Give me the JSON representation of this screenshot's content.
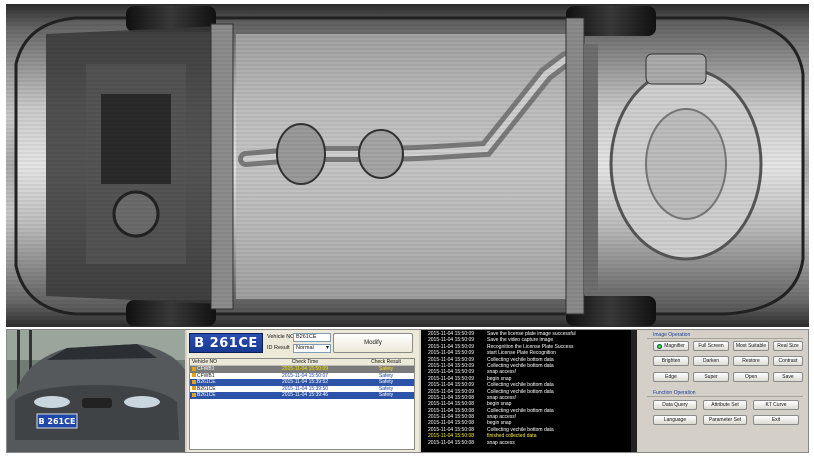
{
  "vehicle_info": {
    "plate_image_text": "B 261CE",
    "vehicle_no_label": "Vehicle NO",
    "vehicle_no_value": "B261CE",
    "id_result_label": "ID Result",
    "id_result_value": "Normal",
    "modify_label": "Modify"
  },
  "table": {
    "headers": [
      "Vehicle NO",
      "Check Time",
      "Check Result"
    ],
    "rows": [
      {
        "no": "CFWB1",
        "time": "2015-11-04 15:50:09",
        "result": "Safety"
      },
      {
        "no": "CFWB1",
        "time": "2015-11-04 15:50:07",
        "result": "Safety"
      },
      {
        "no": "B261CE",
        "time": "2015-11-04 15:39:52",
        "result": "Safety"
      },
      {
        "no": "B261CE",
        "time": "2015-11-04 15:39:50",
        "result": "Safety"
      },
      {
        "no": "B261CE",
        "time": "2015-11-04 15:39:46",
        "result": "Safety"
      }
    ]
  },
  "log": [
    {
      "t": "2015-11-04 15:50:09",
      "m": "Save the license plate image successful"
    },
    {
      "t": "2015-11-04 15:50:09",
      "m": "Save the video capture image"
    },
    {
      "t": "2015-11-04 15:50:09",
      "m": "Recognition the License Plate Success"
    },
    {
      "t": "2015-11-04 15:50:09",
      "m": "start License Plate Recognition"
    },
    {
      "t": "2015-11-04 15:50:09",
      "m": "Collecting vechile bottom data"
    },
    {
      "t": "2015-11-04 15:50:09",
      "m": "Collecting vechile bottom data"
    },
    {
      "t": "2015-11-04 15:50:09",
      "m": "snap access!"
    },
    {
      "t": "2015-11-04 15:50:09",
      "m": "begin snap"
    },
    {
      "t": "2015-11-04 15:50:09",
      "m": "Collecting vechile bottom data"
    },
    {
      "t": "2015-11-04 15:50:09",
      "m": "Collecting vechile bottom data"
    },
    {
      "t": "2015-11-04 15:50:08",
      "m": "snap access!"
    },
    {
      "t": "2015-11-04 15:50:08",
      "m": "begin snap"
    },
    {
      "t": "2015-11-04 15:50:08",
      "m": "Collecting vechile bottom data"
    },
    {
      "t": "2015-11-04 15:50:08",
      "m": "snap access!"
    },
    {
      "t": "2015-11-04 15:50:08",
      "m": "begin snap"
    },
    {
      "t": "2015-11-04 15:50:08",
      "m": "Collecting vechile bottom data"
    },
    {
      "t": "2015-11-04 15:50:08",
      "m": "finished collected data"
    },
    {
      "t": "2015-11-04 15:50:08",
      "m": "snap access"
    }
  ],
  "ops": {
    "image_operation_title": "Image Operation",
    "magnifier": "Magnifier",
    "full_screen": "Full Screen",
    "most_suitable": "Most Suitable",
    "real_size": "Real Size",
    "brighten": "Brighten",
    "darken": "Darken",
    "restore": "Restore",
    "contrast": "Contrast",
    "edge": "Edge",
    "super": "Super",
    "open": "Open",
    "save": "Save",
    "function_operation_title": "Function Operation",
    "data_query": "Data Query",
    "attribute_set": "Attribute Set",
    "kt_curve": "KT Curve",
    "language": "Language",
    "parameter_set": "Parameter Set",
    "exit": "Exit"
  },
  "photo": {
    "plate_text": "B 261CE"
  }
}
